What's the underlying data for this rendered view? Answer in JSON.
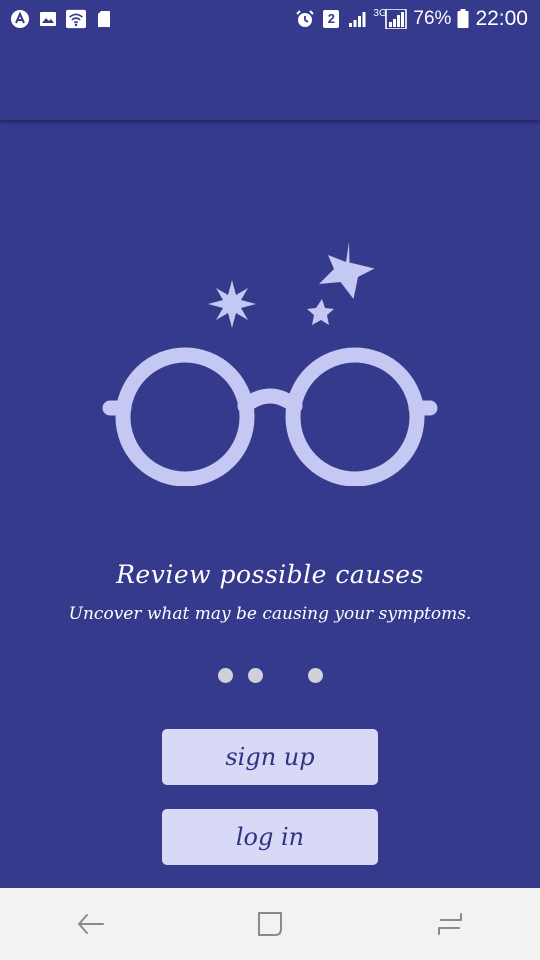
{
  "status_bar": {
    "left_icons": [
      "app-notification-icon",
      "image-icon",
      "wifi-icon",
      "sd-card-icon"
    ],
    "right_icons": [
      "alarm-icon",
      "sim-2-icon",
      "signal-icon",
      "signal-3g-icon",
      "battery-icon"
    ],
    "network_label": "3G",
    "sim_label": "2",
    "battery_percent": "76%",
    "time": "22:00"
  },
  "colors": {
    "background": "#363a8c",
    "illustration": "#c4c8f2",
    "button_bg": "#d8d9f6",
    "button_text": "#2f3386",
    "dot": "#d0d0d8",
    "nav_bar": "#f2f2f2"
  },
  "onboarding": {
    "illustration_icon": "glasses-with-sparkles-icon",
    "title": "Review possible causes",
    "subtitle": "Uncover what may be causing your symptoms.",
    "page_count": 3
  },
  "actions": {
    "sign_up_label": "sign up",
    "log_in_label": "log in"
  },
  "nav_bar": {
    "back_icon": "back-icon",
    "home_icon": "recents-square-icon",
    "recents_icon": "overview-icon"
  }
}
